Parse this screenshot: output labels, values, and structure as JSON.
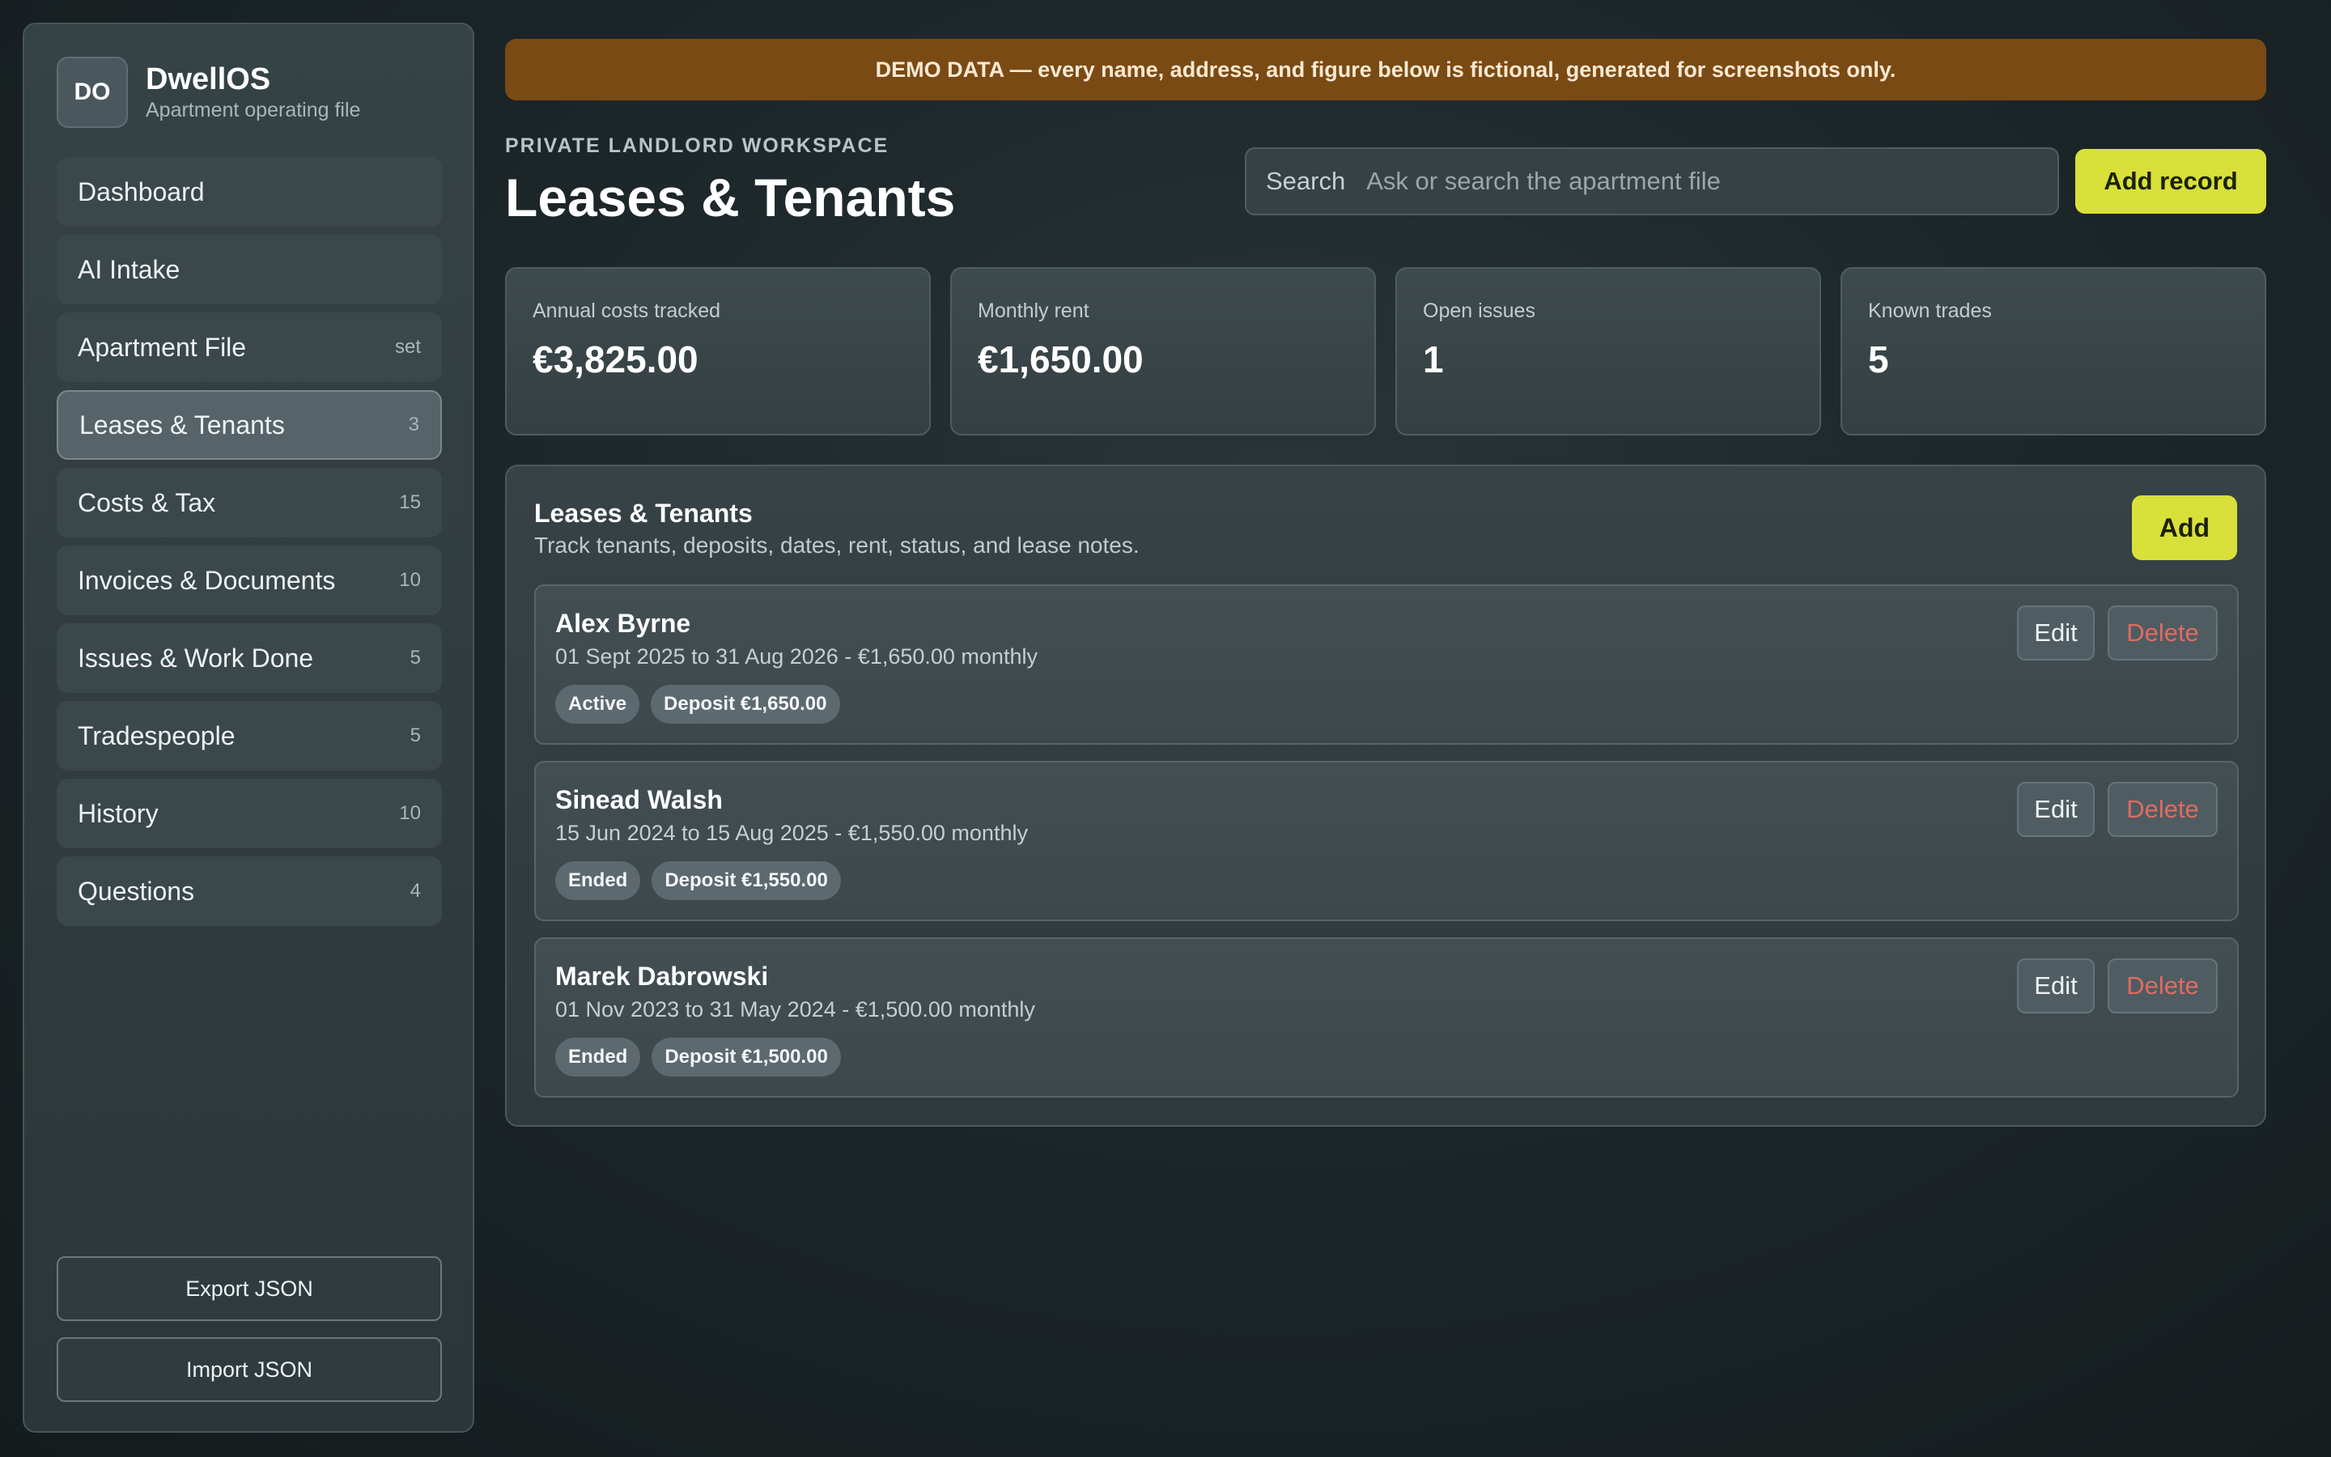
{
  "brand": {
    "logo": "DO",
    "name": "DwellOS",
    "subtitle": "Apartment operating file"
  },
  "sidebar": {
    "items": [
      {
        "label": "Dashboard",
        "count": ""
      },
      {
        "label": "AI Intake",
        "count": ""
      },
      {
        "label": "Apartment File",
        "count": "set"
      },
      {
        "label": "Leases & Tenants",
        "count": "3",
        "active": true
      },
      {
        "label": "Costs & Tax",
        "count": "15"
      },
      {
        "label": "Invoices & Documents",
        "count": "10"
      },
      {
        "label": "Issues & Work Done",
        "count": "5"
      },
      {
        "label": "Tradespeople",
        "count": "5"
      },
      {
        "label": "History",
        "count": "10"
      },
      {
        "label": "Questions",
        "count": "4"
      }
    ],
    "export_label": "Export JSON",
    "import_label": "Import JSON"
  },
  "banner": "DEMO DATA — every name, address, and figure below is fictional, generated for screenshots only.",
  "header": {
    "eyebrow": "PRIVATE LANDLORD WORKSPACE",
    "title": "Leases & Tenants",
    "search_label": "Search",
    "search_placeholder": "Ask or search the apartment file",
    "add_record_label": "Add record"
  },
  "stats": [
    {
      "label": "Annual costs tracked",
      "value": "€3,825.00"
    },
    {
      "label": "Monthly rent",
      "value": "€1,650.00"
    },
    {
      "label": "Open issues",
      "value": "1"
    },
    {
      "label": "Known trades",
      "value": "5"
    }
  ],
  "panel": {
    "title": "Leases & Tenants",
    "subtitle": "Track tenants, deposits, dates, rent, status, and lease notes.",
    "add_label": "Add",
    "edit_label": "Edit",
    "delete_label": "Delete",
    "leases": [
      {
        "name": "Alex Byrne",
        "detail": "01 Sept 2025 to 31 Aug 2026 - €1,650.00 monthly",
        "status": "Active",
        "deposit": "Deposit €1,650.00"
      },
      {
        "name": "Sinead Walsh",
        "detail": "15 Jun 2024 to 15 Aug 2025 - €1,550.00 monthly",
        "status": "Ended",
        "deposit": "Deposit €1,550.00"
      },
      {
        "name": "Marek Dabrowski",
        "detail": "01 Nov 2023 to 31 May 2024 - €1,500.00 monthly",
        "status": "Ended",
        "deposit": "Deposit €1,500.00"
      }
    ]
  }
}
